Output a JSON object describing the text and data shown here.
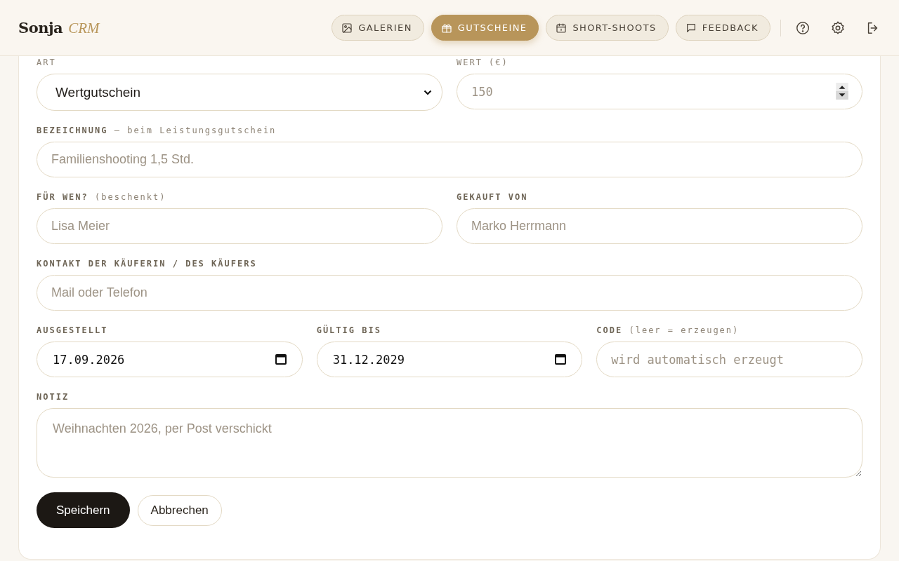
{
  "brand": {
    "name": "Sonja",
    "suffix": "CRM"
  },
  "tabs": [
    {
      "label": "GALERIEN",
      "selected": false
    },
    {
      "label": "GUTSCHEINE",
      "selected": true
    },
    {
      "label": "SHORT-SHOOTS",
      "selected": false
    },
    {
      "label": "FEEDBACK",
      "selected": false
    }
  ],
  "form_rows": [
    [
      {
        "kind": "select",
        "label": "ART",
        "value": "Wertgutschein"
      },
      {
        "kind": "number",
        "label": "WERT (€)",
        "placeholder": "150"
      }
    ],
    [
      {
        "kind": "text",
        "label": "**BEZEICHNUNG** — beim Leistungsgutschein",
        "placeholder": "Familienshooting 1,5 Std."
      }
    ],
    [
      {
        "kind": "text",
        "label": "**FÜR WEN?** (beschenkt)",
        "placeholder": "Lisa Meier"
      },
      {
        "kind": "text",
        "label": "**GEKAUFT VON**",
        "placeholder": "Marko Herrmann"
      }
    ],
    [
      {
        "kind": "text",
        "label": "**KONTAKT DER KÄUFERIN / DES KÄUFERS**",
        "placeholder": "Mail oder Telefon"
      }
    ],
    [
      {
        "kind": "date",
        "label": "**AUSGESTELLT**",
        "value": "17.09.2026"
      },
      {
        "kind": "date",
        "label": "**GÜLTIG BIS**",
        "value": "31.12.2029"
      },
      {
        "kind": "code",
        "label": "**CODE** (leer = erzeugen)",
        "placeholder": "wird automatisch erzeugt"
      }
    ],
    [
      {
        "kind": "textarea",
        "label": "**NOTIZ**",
        "placeholder": "Weihnachten 2026, per Post verschickt"
      }
    ]
  ],
  "buttons": [
    {
      "label": "Speichern",
      "kind": "primary"
    },
    {
      "label": "Abbrechen",
      "kind": "secondary"
    }
  ]
}
